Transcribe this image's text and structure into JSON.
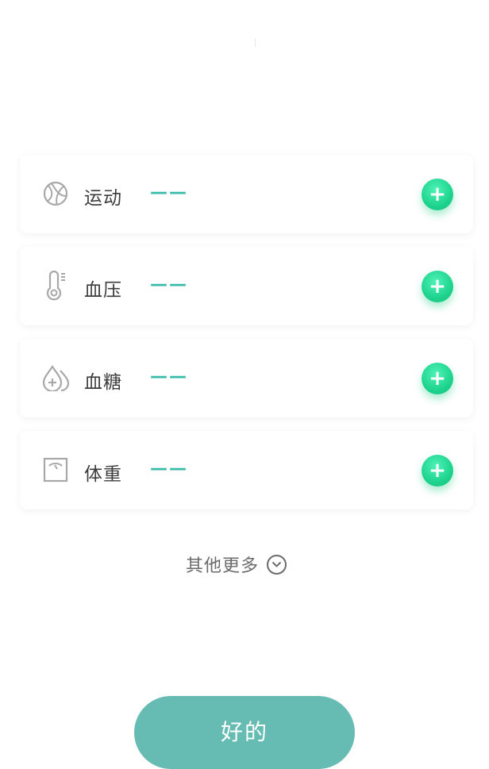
{
  "items": [
    {
      "icon": "sport-ball-icon",
      "label": "运动",
      "value": "——"
    },
    {
      "icon": "thermometer-icon",
      "label": "血压",
      "value": "——"
    },
    {
      "icon": "drops-plus-icon",
      "label": "血糖",
      "value": "——"
    },
    {
      "icon": "scale-icon",
      "label": "体重",
      "value": "——"
    }
  ],
  "more": {
    "label": "其他更多",
    "icon": "chevron-down-circle-icon"
  },
  "confirm_button": {
    "label": "好的"
  },
  "colors": {
    "accent": "#39bba9",
    "button": "#66bcb3",
    "add_button": "#1fd38e"
  }
}
